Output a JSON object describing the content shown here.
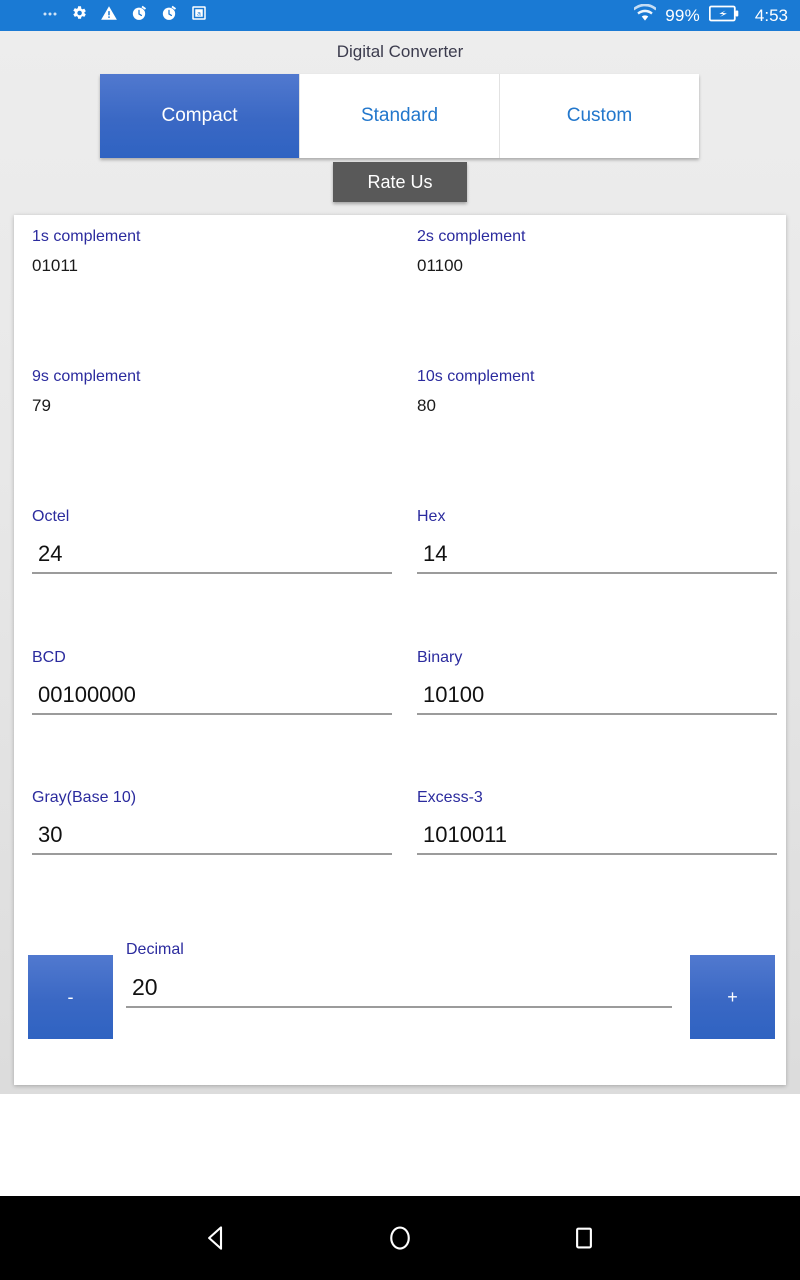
{
  "status_bar": {
    "left_icons": [
      "ellipsis-icon",
      "gear-icon",
      "warning-triangle-icon",
      "alarm-icon",
      "alarm-icon",
      "dictionary-book-icon"
    ],
    "wifi_icon": "wifi-icon",
    "battery_percent": "99%",
    "battery_icon": "battery-charging-icon",
    "clock": "4:53",
    "accent_color": "#1a7ad4"
  },
  "app": {
    "title": "Digital Converter",
    "accent_blue": "#3a68c4",
    "label_color": "#2b2b9e"
  },
  "tabs": [
    {
      "label": "Compact",
      "active": true
    },
    {
      "label": "Standard",
      "active": false
    },
    {
      "label": "Custom",
      "active": false
    }
  ],
  "rate_us": {
    "label": "Rate Us"
  },
  "fields": {
    "ones_complement": {
      "label": "1s complement",
      "value": "01011",
      "editable": false
    },
    "twos_complement": {
      "label": "2s complement",
      "value": "01100",
      "editable": false
    },
    "nines_complement": {
      "label": "9s complement",
      "value": "79",
      "editable": false
    },
    "tens_complement": {
      "label": "10s complement",
      "value": "80",
      "editable": false
    },
    "octal": {
      "label": "Octel",
      "value": "24",
      "editable": true
    },
    "hex": {
      "label": "Hex",
      "value": "14",
      "editable": true
    },
    "bcd": {
      "label": "BCD",
      "value": "00100000",
      "editable": true
    },
    "binary": {
      "label": "Binary",
      "value": "10100",
      "editable": true
    },
    "gray": {
      "label": "Gray(Base 10)",
      "value": "30",
      "editable": true
    },
    "excess3": {
      "label": "Excess-3",
      "value": "1010011",
      "editable": true
    },
    "decimal": {
      "label": "Decimal",
      "value": "20",
      "editable": true
    }
  },
  "stepper": {
    "decrement_label": "-",
    "increment_label": "+"
  },
  "nav_bar": {
    "back": "back-triangle-icon",
    "home": "home-circle-icon",
    "recents": "recents-square-icon"
  }
}
